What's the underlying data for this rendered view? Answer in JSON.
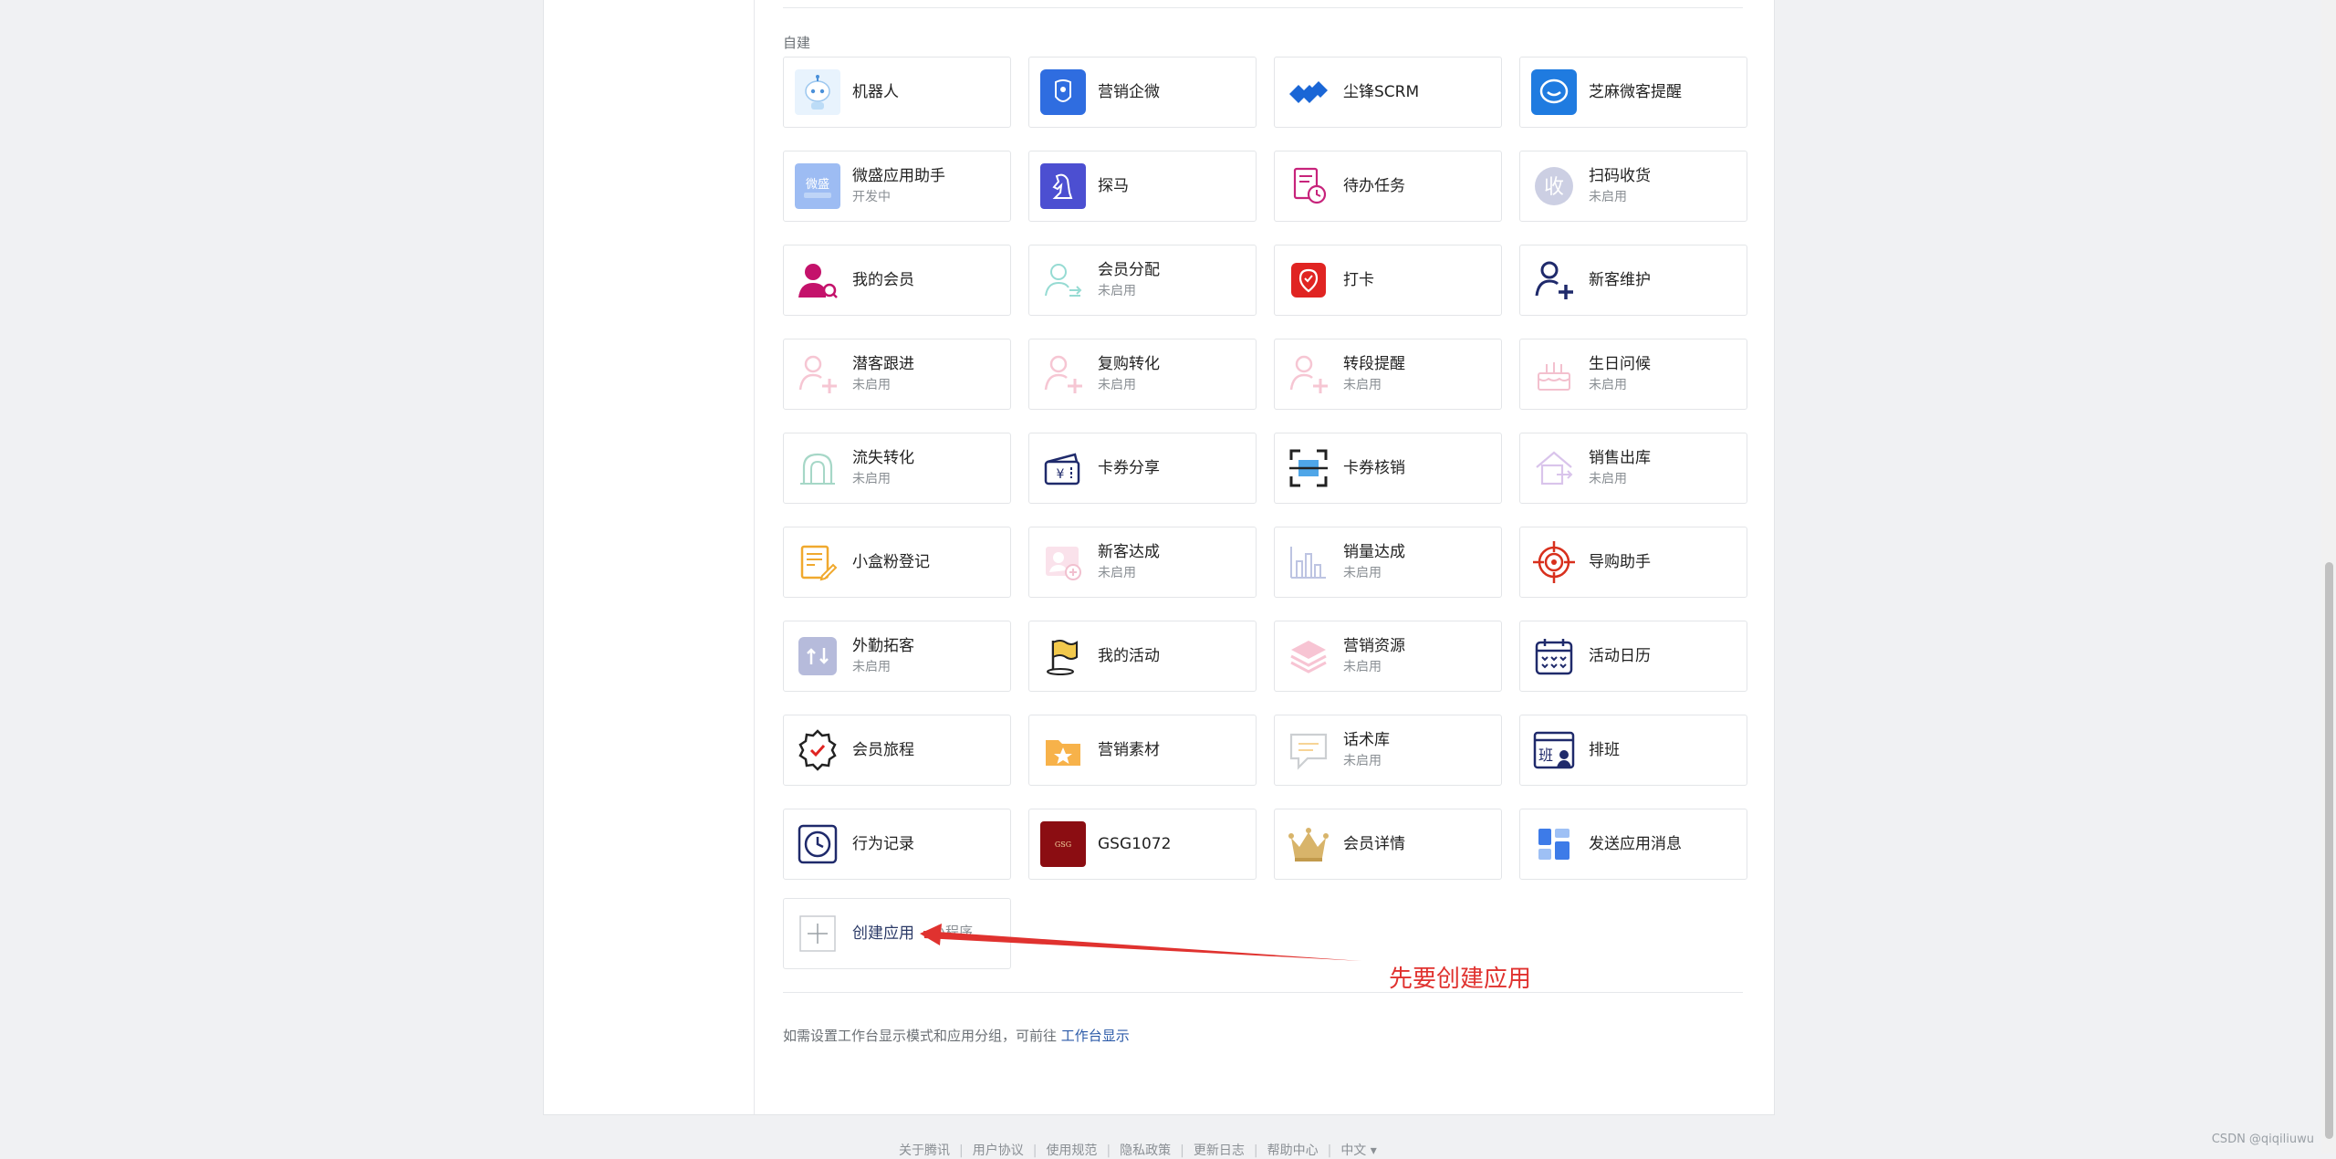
{
  "section_label": "自建",
  "apps": [
    {
      "name": "机器人",
      "status": "",
      "icon": "robot-icon"
    },
    {
      "name": "营销企微",
      "status": "",
      "icon": "marketing-wecom-icon"
    },
    {
      "name": "尘锋SCRM",
      "status": "",
      "icon": "chenfeng-logo-icon"
    },
    {
      "name": "芝麻微客提醒",
      "status": "",
      "icon": "chat-bubble-icon"
    },
    {
      "name": "微盛应用助手",
      "status": "开发中",
      "icon": "weisheng-icon"
    },
    {
      "name": "探马",
      "status": "",
      "icon": "knight-horse-icon"
    },
    {
      "name": "待办任务",
      "status": "",
      "icon": "task-clock-icon"
    },
    {
      "name": "扫码收货",
      "status": "未启用",
      "icon": "receive-icon"
    },
    {
      "name": "我的会员",
      "status": "",
      "icon": "member-search-icon"
    },
    {
      "name": "会员分配",
      "status": "未启用",
      "icon": "member-transfer-icon"
    },
    {
      "name": "打卡",
      "status": "",
      "icon": "check-in-icon"
    },
    {
      "name": "新客维护",
      "status": "",
      "icon": "user-add-icon"
    },
    {
      "name": "潜客跟进",
      "status": "未启用",
      "icon": "user-add-icon"
    },
    {
      "name": "复购转化",
      "status": "未启用",
      "icon": "user-add-icon"
    },
    {
      "name": "转段提醒",
      "status": "未启用",
      "icon": "user-add-icon"
    },
    {
      "name": "生日问候",
      "status": "未启用",
      "icon": "birthday-cake-icon"
    },
    {
      "name": "流失转化",
      "status": "未启用",
      "icon": "arch-icon"
    },
    {
      "name": "卡券分享",
      "status": "",
      "icon": "coupon-wallet-icon"
    },
    {
      "name": "卡券核销",
      "status": "",
      "icon": "scan-frame-icon"
    },
    {
      "name": "销售出库",
      "status": "未启用",
      "icon": "house-export-icon"
    },
    {
      "name": "小盒粉登记",
      "status": "",
      "icon": "note-edit-icon"
    },
    {
      "name": "新客达成",
      "status": "未启用",
      "icon": "user-card-icon"
    },
    {
      "name": "销量达成",
      "status": "未启用",
      "icon": "bar-chart-icon"
    },
    {
      "name": "导购助手",
      "status": "",
      "icon": "target-icon"
    },
    {
      "name": "外勤拓客",
      "status": "未启用",
      "icon": "up-down-arrows-icon"
    },
    {
      "name": "我的活动",
      "status": "",
      "icon": "flag-icon"
    },
    {
      "name": "营销资源",
      "status": "未启用",
      "icon": "layers-icon"
    },
    {
      "name": "活动日历",
      "status": "",
      "icon": "calendar-icon"
    },
    {
      "name": "会员旅程",
      "status": "",
      "icon": "badge-check-icon"
    },
    {
      "name": "营销素材",
      "status": "",
      "icon": "folder-star-icon"
    },
    {
      "name": "话术库",
      "status": "未启用",
      "icon": "speech-icon"
    },
    {
      "name": "排班",
      "status": "",
      "icon": "schedule-icon"
    },
    {
      "name": "行为记录",
      "status": "",
      "icon": "clock-icon"
    },
    {
      "name": "GSG1072",
      "status": "",
      "icon": "gsg-logo-icon"
    },
    {
      "name": "会员详情",
      "status": "",
      "icon": "crown-icon"
    },
    {
      "name": "发送应用消息",
      "status": "",
      "icon": "dashboard-icon"
    }
  ],
  "create_app": {
    "label": "创建应用",
    "overlap_text": "小程序"
  },
  "hint": {
    "text": "如需设置工作台显示模式和应用分组，可前往 ",
    "link": "工作台显示"
  },
  "annotation": "先要创建应用",
  "footer": [
    "关于腾讯",
    "用户协议",
    "使用规范",
    "隐私政策",
    "更新日志",
    "帮助中心",
    "中文 ▾"
  ],
  "watermark": "CSDN @qiqiliuwu",
  "colors": {
    "accent": "#2b5aa8",
    "annotation": "#e0322f"
  }
}
